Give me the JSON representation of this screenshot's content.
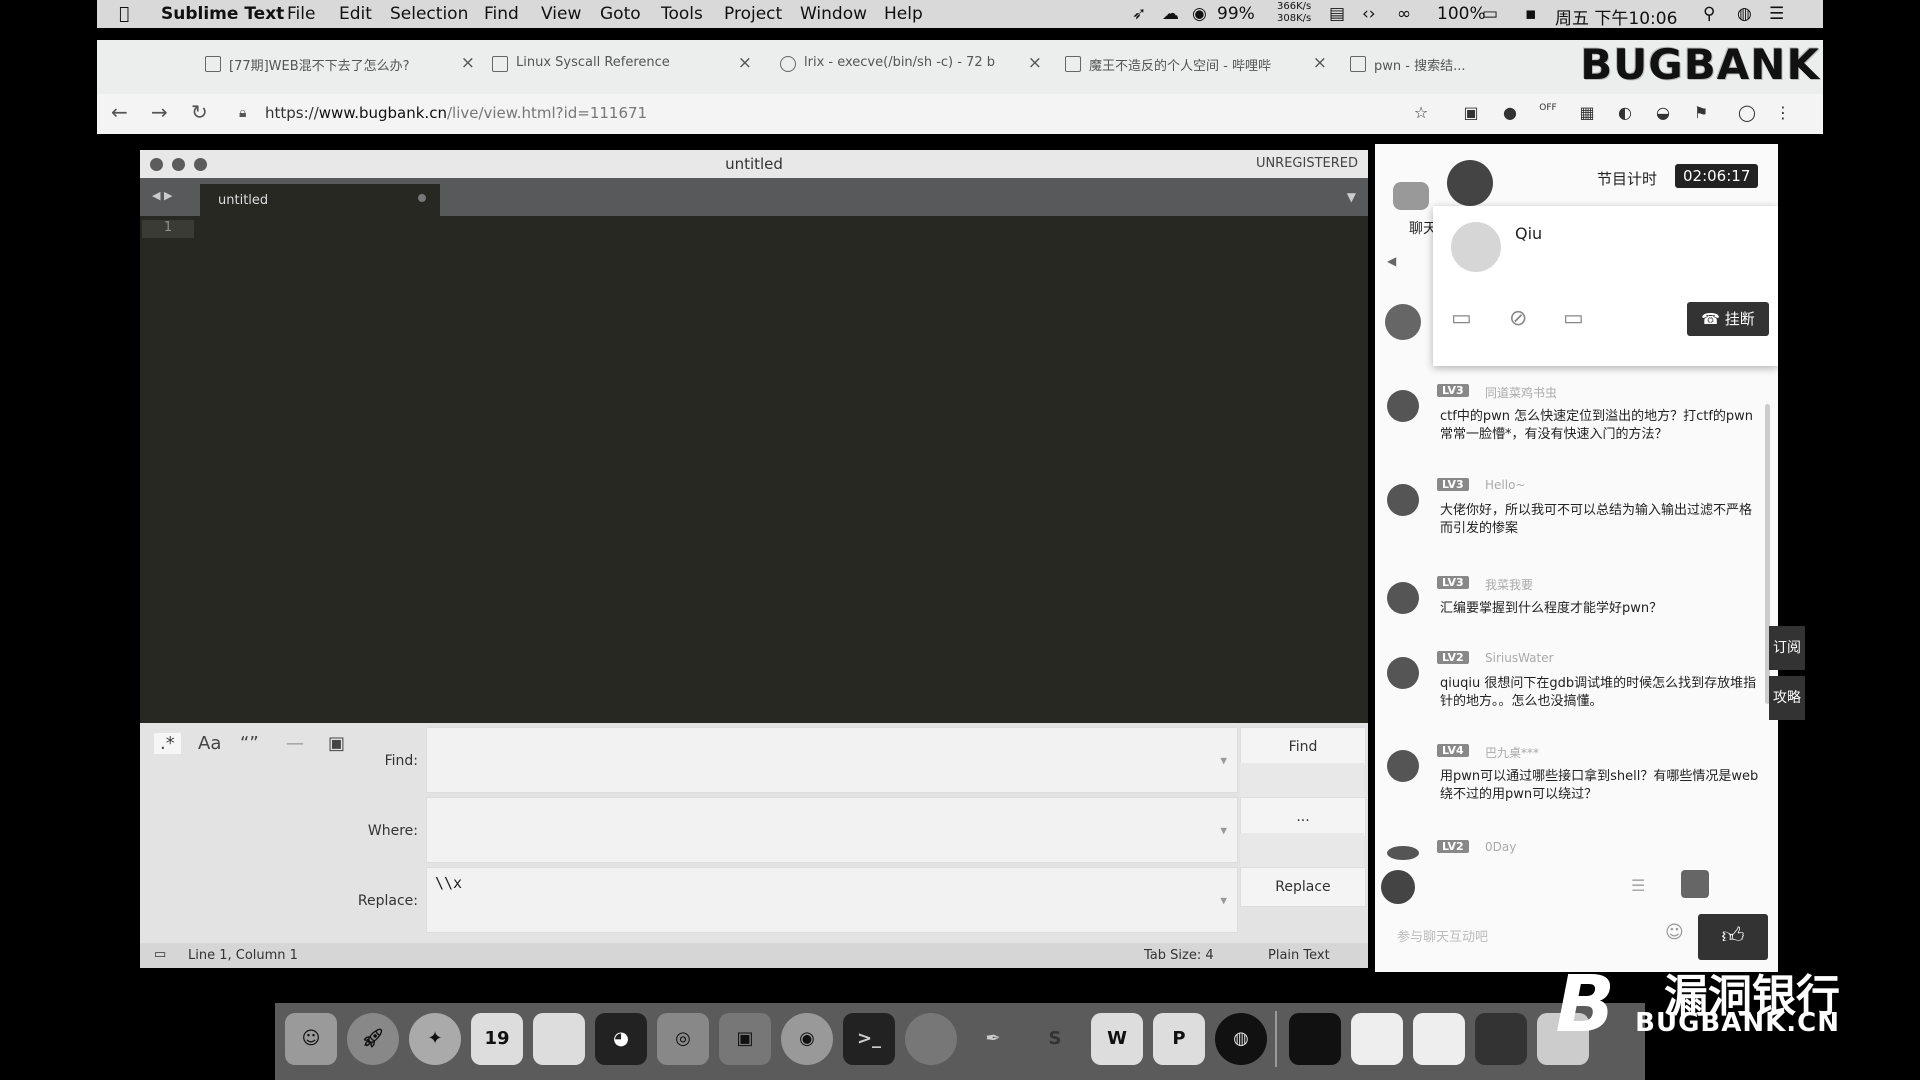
{
  "menubar": {
    "app_name": "Sublime Text",
    "items": [
      "File",
      "Edit",
      "Selection",
      "Find",
      "View",
      "Goto",
      "Tools",
      "Project",
      "Window",
      "Help"
    ],
    "battery": "99%",
    "net_up": "366K/s",
    "net_down": "308K/s",
    "volume": "100%",
    "clock": "周五 下午10:06"
  },
  "browser": {
    "tabs": [
      {
        "title": "[77期]WEB混不下去了怎么办?"
      },
      {
        "title": "Linux Syscall Reference"
      },
      {
        "title": "lrix - execve(/bin/sh -c) - 72 b"
      },
      {
        "title": "魔王不造反的个人空间 - 哔哩哔"
      },
      {
        "title": "pwn - 搜索结..."
      }
    ],
    "url_scheme": "https://",
    "url_host": "www.bugbank.cn",
    "url_path": "/live/view.html?id=111671"
  },
  "watermark_top": "BUGBANK",
  "sublime": {
    "window_title": "untitled",
    "unregistered": "UNREGISTERED",
    "tab_label": "untitled",
    "line_number": "1",
    "find_panel": {
      "find_label": "Find:",
      "where_label": "Where:",
      "replace_label": "Replace:",
      "find_value": "",
      "where_value": "",
      "replace_value": "\\\\x",
      "find_button": "Find",
      "where_button": "...",
      "replace_button": "Replace",
      "options": [
        ".*",
        "Aa",
        "“”",
        "—",
        "▣"
      ]
    },
    "status": {
      "position": "Line 1, Column 1",
      "tab_size": "Tab Size: 4",
      "syntax": "Plain Text"
    }
  },
  "live": {
    "timer_label": "节目计时",
    "timer_value": "02:06:17",
    "chat_tab": "聊天",
    "call_popup": {
      "name": "Qiu",
      "hangup_label": "挂断"
    },
    "messages": [
      {
        "level": "LV3",
        "name": "同道菜鸡书虫",
        "text": "ctf中的pwn 怎么快速定位到溢出的地方？打ctf的pwn常常一脸懵*，有没有快速入门的方法？"
      },
      {
        "level": "LV3",
        "name": "Hello~",
        "text": "大佬你好，所以我可不可以总结为输入输出过滤不严格而引发的惨案"
      },
      {
        "level": "LV3",
        "name": "我菜我要",
        "text": "汇编要掌握到什么程度才能学好pwn？"
      },
      {
        "level": "LV2",
        "name": "SiriusWater",
        "text": "qiuqiu 很想问下在gdb调试堆的时候怎么找到存放堆指针的地方。。怎么也没搞懂。"
      },
      {
        "level": "LV4",
        "name": "巴九桌***",
        "text": "用pwn可以通过哪些接口拿到shell？有哪些情况是web绕不过的用pwn可以绕过？"
      },
      {
        "level": "LV2",
        "name": "0Day",
        "text": ""
      }
    ],
    "input_placeholder": "参与聊天互动吧",
    "side_tags": [
      "订阅",
      "攻略"
    ]
  },
  "dock": {
    "icons": [
      "finder",
      "launchpad",
      "safari",
      "calendar",
      "notes",
      "qq",
      "wechat",
      "preview",
      "chrome",
      "terminal",
      "app",
      "pen",
      "sublime",
      "word",
      "powerpoint",
      "browser",
      "folder",
      "files",
      "files2",
      "screen",
      "trash"
    ],
    "calendar_day": "19"
  },
  "watermark_br": {
    "title": "漏洞银行",
    "sub": "BUGBANK.CN",
    "letter": "B"
  }
}
